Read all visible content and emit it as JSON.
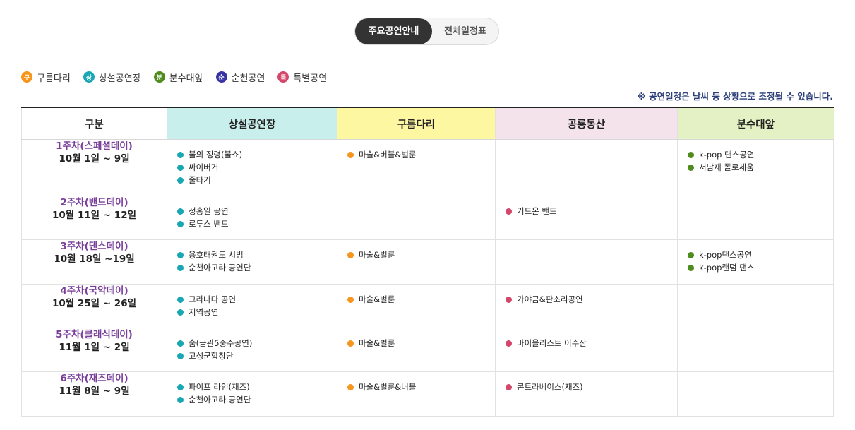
{
  "tabs": {
    "active": "주요공연안내",
    "inactive": "전체일정표"
  },
  "legend": [
    {
      "badge": "구",
      "label": "구름다리",
      "color": "#f6961e"
    },
    {
      "badge": "상",
      "label": "상설공연장",
      "color": "#19a7b3"
    },
    {
      "badge": "분",
      "label": "분수대앞",
      "color": "#4e8c1e"
    },
    {
      "badge": "순",
      "label": "순천공연",
      "color": "#3a35a6"
    },
    {
      "badge": "특",
      "label": "특별공연",
      "color": "#d6456a"
    }
  ],
  "notice": "※ 공연일정은 날씨 등 상황으로 조정될 수 있습니다.",
  "table": {
    "headers": [
      "구분",
      "상설공연장",
      "구름다리",
      "공룡동산",
      "분수대앞"
    ],
    "header_colors": [
      "#ffffff",
      "#c9efec",
      "#fdf7a2",
      "#f5e3ec",
      "#e3f1c4"
    ],
    "rows": [
      {
        "week": "1주차(스페셜데이)",
        "date": "10월 1일 ~ 9일",
        "c1": [
          "불의 정령(불쇼)",
          "싸이버거",
          "줄타기"
        ],
        "c2": [
          "마술&버블&벌룬"
        ],
        "c3": [],
        "c4": [
          "k-pop 댄스공연",
          "서남재 폴로세움"
        ]
      },
      {
        "week": "2주차(밴드데이)",
        "date": "10월 11일 ~ 12일",
        "c1": [
          "정홍일 공연",
          "로투스 밴드"
        ],
        "c2": [],
        "c3": [
          "기드온 밴드"
        ],
        "c4": []
      },
      {
        "week": "3주차(댄스데이)",
        "date": "10월 18일 ~19일",
        "c1": [
          "용호태권도 시범",
          "순천아고라 공연단"
        ],
        "c2": [
          "마술&벌룬"
        ],
        "c3": [],
        "c4": [
          "k-pop댄스공연",
          "k-pop랜덤 댄스"
        ]
      },
      {
        "week": "4주차(국악데이)",
        "date": "10월 25일 ~ 26일",
        "c1": [
          "그라나다 공연",
          "지역공연"
        ],
        "c2": [
          "마술&벌룬"
        ],
        "c3": [
          "가야금&판소리공연"
        ],
        "c4": []
      },
      {
        "week": "5주차(클래식데이)",
        "date": "11월 1일 ~ 2일",
        "c1": [
          "숨(금관5중주공연)",
          "고성군합창단"
        ],
        "c2": [
          "마술&벌룬"
        ],
        "c3": [
          "바이올리스트 이수산"
        ],
        "c4": []
      },
      {
        "week": "6주차(재즈데이)",
        "date": "11월 8일 ~ 9일",
        "c1": [
          "파이프 라인(재즈)",
          "순천아고라 공연단"
        ],
        "c2": [
          "마술&벌룬&버블"
        ],
        "c3": [
          "콘트라베이스(재즈)"
        ],
        "c4": []
      }
    ]
  }
}
